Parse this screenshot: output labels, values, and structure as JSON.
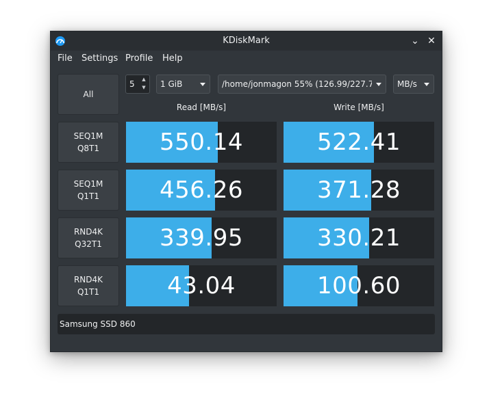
{
  "window": {
    "title": "KDiskMark"
  },
  "menu": [
    "File",
    "Settings",
    "Profile",
    "Help"
  ],
  "toolbar": {
    "all_label": "All",
    "runs_value": "5",
    "size_value": "1 GiB",
    "path_value": "/home/jonmagon 55% (126.99/227.7",
    "unit_value": "MB/s"
  },
  "headers": {
    "read": "Read [MB/s]",
    "write": "Write [MB/s]"
  },
  "tests": [
    {
      "line1": "SEQ1M",
      "line2": "Q8T1",
      "read": "550.14",
      "write": "522.41",
      "read_fill": 0.61,
      "write_fill": 0.6
    },
    {
      "line1": "SEQ1M",
      "line2": "Q1T1",
      "read": "456.26",
      "write": "371.28",
      "read_fill": 0.59,
      "write_fill": 0.58
    },
    {
      "line1": "RND4K",
      "line2": "Q32T1",
      "read": "339.95",
      "write": "330.21",
      "read_fill": 0.57,
      "write_fill": 0.57
    },
    {
      "line1": "RND4K",
      "line2": "Q1T1",
      "read": "43.04",
      "write": "100.60",
      "read_fill": 0.42,
      "write_fill": 0.49
    }
  ],
  "status": {
    "drive": "Samsung SSD 860"
  },
  "colors": {
    "bar": "#3daee9",
    "background": "#31363b",
    "result_bg": "#232629"
  }
}
